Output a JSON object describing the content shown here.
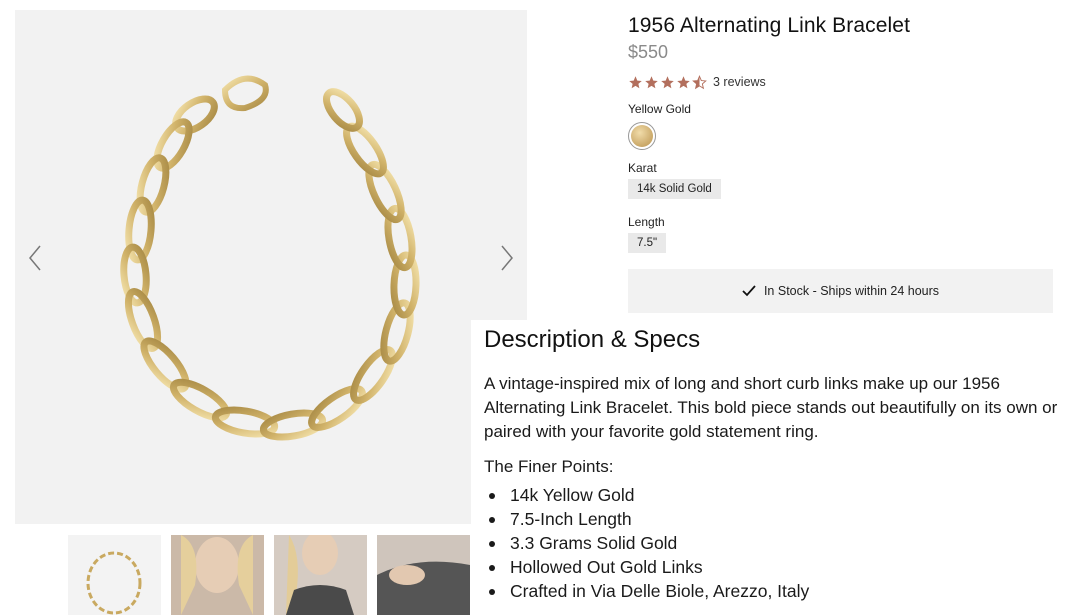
{
  "product": {
    "title": "1956 Alternating Link Bracelet",
    "price": "$550",
    "rating": 4.5,
    "reviews_label": "3 reviews",
    "star_color": "#b36f5d"
  },
  "options": {
    "color_label": "Yellow Gold",
    "karat_label": "Karat",
    "karat_value": "14k Solid Gold",
    "length_label": "Length",
    "length_value": "7.5\""
  },
  "stock": {
    "text": "In Stock - Ships within 24 hours"
  },
  "gallery": {
    "thumbnails": [
      "bracelet",
      "model-neck",
      "model-chest",
      "model-wrist"
    ]
  },
  "description": {
    "heading": "Description & Specs",
    "body": "A vintage-inspired mix of long and short curb links make up our 1956 Alternating Link Bracelet. This bold piece stands out beautifully on its own or paired with your favorite gold statement ring.",
    "finer_title": "The Finer Points:",
    "points": [
      "14k Yellow Gold",
      "7.5-Inch Length",
      "3.3 Grams Solid Gold",
      "Hollowed Out Gold Links",
      "Crafted in Via Delle Biole, Arezzo, Italy"
    ]
  }
}
